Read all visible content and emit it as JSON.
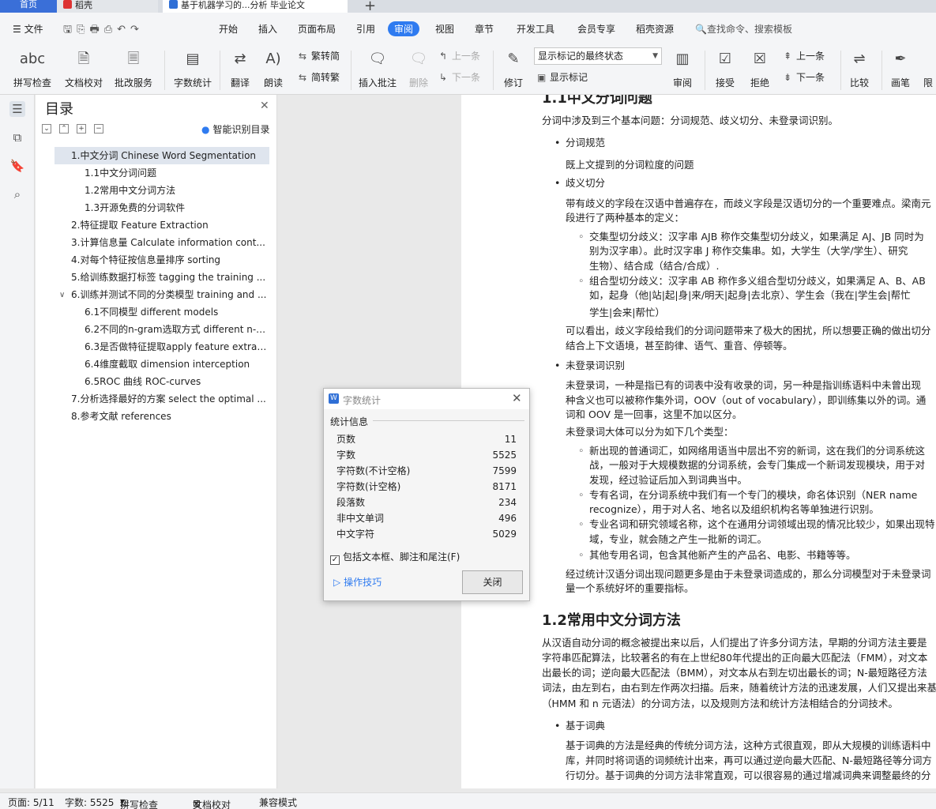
{
  "tabs": [
    {
      "label": "首页"
    },
    {
      "label": "稻壳"
    },
    {
      "label": "基于机器学习的...分析 毕业论文"
    }
  ],
  "menu": {
    "file": "文件",
    "items": [
      "开始",
      "插入",
      "页面布局",
      "引用",
      "审阅",
      "视图",
      "章节",
      "开发工具",
      "会员专享",
      "稻壳资源"
    ],
    "active": "审阅",
    "search": "查找命令、搜索模板"
  },
  "ribbon": {
    "spell_check": "拼写检查",
    "doc_proof": "文档校对",
    "batch_service": "批改服务",
    "word_count": "字数统计",
    "translate": "翻译",
    "read_aloud": "朗读",
    "trad_conv": "繁转简",
    "simp_conv": "简转繁",
    "insert_comment": "插入批注",
    "delete": "删除",
    "prev_comment": "上一条",
    "next_comment": "下一条",
    "track": "修订",
    "markup_mode": "显示标记的最终状态",
    "show_markup": "显示标记",
    "review": "审阅",
    "accept": "接受",
    "reject": "拒绝",
    "prev_change": "上一条",
    "next_change": "下一条",
    "compare": "比较",
    "ink": "画笔",
    "restrict": "限"
  },
  "toc": {
    "title": "目录",
    "smart": "智能识别目录",
    "items": [
      {
        "label": "1.中文分词 Chinese Word Segmentation"
      },
      {
        "label": "1.1中文分词问题"
      },
      {
        "label": "1.2常用中文分词方法"
      },
      {
        "label": "1.3开源免费的分词软件"
      },
      {
        "label": "2.特征提取 Feature Extraction"
      },
      {
        "label": "3.计算信息量 Calculate information cont..."
      },
      {
        "label": "4.对每个特征按信息量排序 sorting"
      },
      {
        "label": "5.给训练数据打标签 tagging the training ..."
      },
      {
        "label": "6.训练并测试不同的分类模型 training and ..."
      },
      {
        "label": "6.1不同模型 different models"
      },
      {
        "label": "6.2不同的n-gram选取方式 different n- ..."
      },
      {
        "label": "6.3是否做特征提取apply feature extrac..."
      },
      {
        "label": "6.4维度截取 dimension interception"
      },
      {
        "label": "6.5ROC 曲线 ROC-curves"
      },
      {
        "label": "7.分析选择最好的方案 select the optimal ..."
      },
      {
        "label": "8.参考文献 references"
      }
    ]
  },
  "document": {
    "heading_top": "1.1中文分词问题",
    "lines": [
      "分词中涉及到三个基本问题：分词规范、歧义切分、未登录词识别。",
      "分词规范",
      "既上文提到的分词粒度的问题",
      "歧义切分",
      "带有歧义的字段在汉语中普遍存在，而歧义字段是汉语切分的一个重要难点。梁南元",
      "段进行了两种基本的定义：",
      "交集型切分歧义：汉字串 AJB 称作交集型切分歧义，如果满足 AJ、JB 同时为",
      "别为汉字串）。此时汉字串 J 称作交集串。如，大学生（大学/学生）、研究",
      "生物）、结合成（结合/合成）.",
      "组合型切分歧义：汉字串 AB 称作多义组合型切分歧义，如果满足 A、B、AB",
      "如，起身（他|站|起|身|来/明天|起身|去北京）、学生会（我在|学生会|帮忙",
      "学生|会来|帮忙）",
      "可以看出，歧义字段给我们的分词问题带来了极大的困扰，所以想要正确的做出切分",
      "结合上下文语境，甚至韵律、语气、重音、停顿等。",
      "未登录词识别",
      "未登录词，一种是指已有的词表中没有收录的词，另一种是指训练语料中未曾出现",
      "种含义也可以被称作集外词，OOV（out of vocabulary），即训练集以外的词。通",
      "词和 OOV 是一回事，这里不加以区分。",
      "未登录词大体可以分为如下几个类型：",
      "新出现的普通词汇，如网络用语当中层出不穷的新词，这在我们的分词系统这",
      "战，一般对于大规模数据的分词系统，会专门集成一个新词发现模块，用于对",
      "发现，经过验证后加入到词典当中。",
      "专有名词，在分词系统中我们有一个专门的模块，命名体识别（NER name",
      "recognize），用于对人名、地名以及组织机构名等单独进行识别。",
      "专业名词和研究领域名称，这个在通用分词领域出现的情况比较少，如果出现特",
      "域，专业，就会随之产生一批新的词汇。",
      "其他专用名词，包含其他新产生的产品名、电影、书籍等等。",
      "经过统计汉语分词出现问题更多是由于未登录词造成的，那么分词模型对于未登录词",
      "量一个系统好坏的重要指标。",
      "从汉语自动分词的概念被提出来以后，人们提出了许多分词方法，早期的分词方法主要是",
      "字符串匹配算法，比较著名的有在上世纪80年代提出的正向最大匹配法（FMM），对文本",
      "出最长的词；逆向最大匹配法（BMM），对文本从右到左切出最长的词；N-最短路径方法",
      "词法，由左到右，由右到左作两次扫描。后来，随着统计方法的迅速发展，人们又提出来基",
      "（HMM 和 n 元语法）的分词方法，以及规则方法和统计方法相结合的分词技术。",
      "基于词典",
      "基于词典的方法是经典的传统分词方法，这种方式很直观，即从大规模的训练语料中",
      "库，并同时将词语的词频统计出来，再可以通过逆向最大匹配、N-最短路径等分词方",
      "行切分。基于词典的分词方法非常直观，可以很容易的通过增减词典来调整最终的分"
    ],
    "heading_12": "1.2常用中文分词方法"
  },
  "dialog": {
    "title": "字数统计",
    "section": "统计信息",
    "rows": [
      {
        "label": "页数",
        "value": "11"
      },
      {
        "label": "字数",
        "value": "5525"
      },
      {
        "label": "字符数(不计空格)",
        "value": "7599"
      },
      {
        "label": "字符数(计空格)",
        "value": "8171"
      },
      {
        "label": "段落数",
        "value": "234"
      },
      {
        "label": "非中文单词",
        "value": "496"
      },
      {
        "label": "中文字符",
        "value": "5029"
      }
    ],
    "checkbox": "包括文本框、脚注和尾注(F)",
    "tips": "操作技巧",
    "close": "关闭"
  },
  "status": {
    "page": "页面: 5/11",
    "words": "字数: 5525",
    "spell": "拼写检查",
    "proof": "文档校对",
    "compat": "兼容模式"
  },
  "colors": {
    "accent": "#2f7bf0",
    "home_tab": "#3a6fd8"
  }
}
